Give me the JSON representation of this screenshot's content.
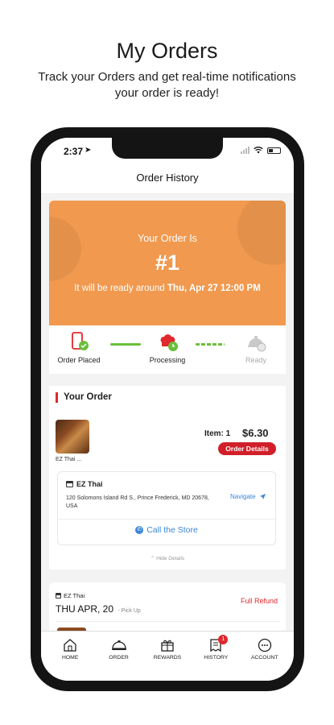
{
  "promo": {
    "title": "My Orders",
    "subtitle": "Track your Orders and get real-time notifications your order is ready!"
  },
  "status_bar": {
    "time": "2:37"
  },
  "header": {
    "title": "Order History"
  },
  "current_order": {
    "label": "Your Order Is",
    "number": "#1",
    "ready_prefix": "It will be ready around",
    "ready_time": "Thu, Apr 27 12:00 PM",
    "accent_color": "#f0994f"
  },
  "progress": {
    "steps": [
      {
        "label": "Order Placed",
        "state": "done",
        "icon": "phone-check-icon"
      },
      {
        "label": "Processing",
        "state": "active",
        "icon": "chef-hat-icon"
      },
      {
        "label": "Ready",
        "state": "pending",
        "icon": "cloche-icon"
      }
    ],
    "color": "#6abf3a"
  },
  "your_order": {
    "section_title": "Your Order",
    "item_thumb_label": "EZ Thai ...",
    "item_count": "Item: 1",
    "price": "$6.30",
    "details_button": "Order Details",
    "store": {
      "name": "EZ Thai",
      "address": "120 Solomons Island Rd S., Prince Frederick, MD 20678, USA",
      "navigate": "Navigate",
      "call": "Call the Store"
    },
    "hide_details": "Hide Details"
  },
  "history": [
    {
      "store": "EZ Thai",
      "date": "THU APR, 20",
      "mode": "- Pick Up",
      "status": "Full Refund"
    }
  ],
  "tabbar": {
    "tabs": [
      {
        "label": "HOME",
        "icon": "home-icon"
      },
      {
        "label": "ORDER",
        "icon": "cloche-icon"
      },
      {
        "label": "REWARDS",
        "icon": "gift-icon"
      },
      {
        "label": "HISTORY",
        "icon": "receipt-icon",
        "badge": "1"
      },
      {
        "label": "ACCOUNT",
        "icon": "account-icon"
      }
    ]
  },
  "colors": {
    "brand_red": "#e0282e",
    "link_blue": "#3a86d6"
  }
}
